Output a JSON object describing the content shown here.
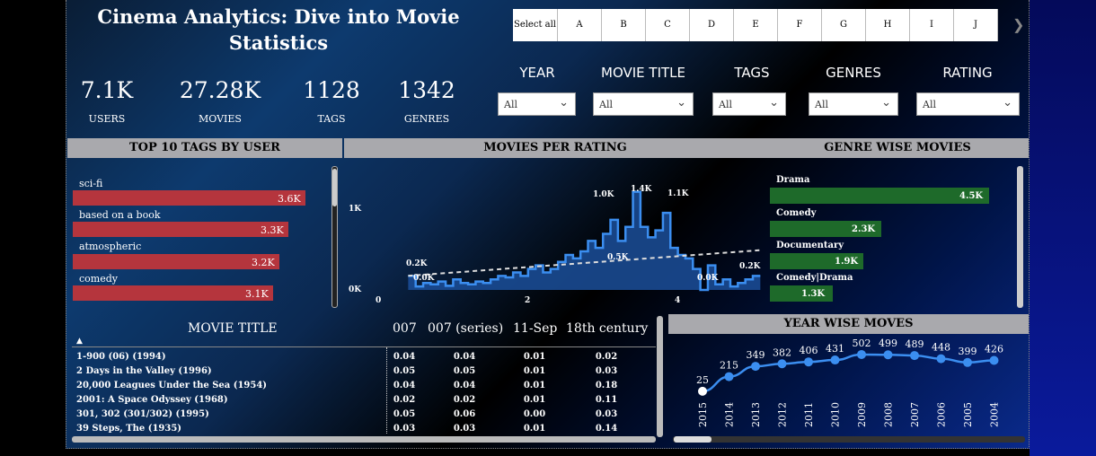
{
  "header": {
    "title": "Cinema Analytics: Dive into Movie Statistics"
  },
  "kpis": [
    {
      "value": "7.1K",
      "label": "USERS"
    },
    {
      "value": "27.28K",
      "label": "MOVIES"
    },
    {
      "value": "1128",
      "label": "TAGS"
    },
    {
      "value": "1342",
      "label": "GENRES"
    }
  ],
  "letter_slicer": [
    "Select all",
    "A",
    "B",
    "C",
    "D",
    "E",
    "F",
    "G",
    "H",
    "I",
    "J"
  ],
  "filters": [
    {
      "label": "YEAR",
      "value": "All"
    },
    {
      "label": "MOVIE TITLE",
      "value": "All"
    },
    {
      "label": "TAGS",
      "value": "All"
    },
    {
      "label": "GENRES",
      "value": "All"
    },
    {
      "label": "RATING",
      "value": "All"
    }
  ],
  "icons": {
    "next": "chevron-right-icon",
    "dropdown": "chevron-down-icon",
    "sort": "sort-ascending-icon"
  },
  "colors": {
    "tag_bar": "#b5353d",
    "genre_bar": "#1e6a2a",
    "histogram": "#3b8ef0",
    "line": "#3b8ef0",
    "header_bg": "#a9a9ad"
  },
  "top_tags": {
    "title": "TOP 10 TAGS BY USER",
    "items": [
      {
        "label": "sci-fi",
        "value": "3.6K",
        "num": 3.6
      },
      {
        "label": "based on a book",
        "value": "3.3K",
        "num": 3.3
      },
      {
        "label": "atmospheric",
        "value": "3.2K",
        "num": 3.2
      },
      {
        "label": "comedy",
        "value": "3.1K",
        "num": 3.1
      }
    ]
  },
  "genre_movies": {
    "title": "GENRE WISE MOVIES",
    "items": [
      {
        "label": "Drama",
        "value": "4.5K",
        "num": 4.5
      },
      {
        "label": "Comedy",
        "value": "2.3K",
        "num": 2.3
      },
      {
        "label": "Documentary",
        "value": "1.9K",
        "num": 1.9
      },
      {
        "label": "Comedy|Drama",
        "value": "1.3K",
        "num": 1.3
      }
    ]
  },
  "chart_data": [
    {
      "type": "area",
      "title": "MOVIES PER RATING",
      "x_ticks": [
        "0",
        "2",
        "4"
      ],
      "y_ticks": [
        "0K",
        "1K"
      ],
      "xlim": [
        0,
        5
      ],
      "ylim": [
        0,
        1.6
      ],
      "x": [
        0.4,
        0.5,
        0.6,
        0.7,
        0.8,
        0.9,
        1.0,
        1.1,
        1.2,
        1.3,
        1.4,
        1.5,
        1.6,
        1.7,
        1.8,
        1.9,
        2.0,
        2.1,
        2.2,
        2.3,
        2.4,
        2.5,
        2.6,
        2.7,
        2.8,
        2.9,
        3.0,
        3.1,
        3.2,
        3.3,
        3.4,
        3.5,
        3.6,
        3.7,
        3.8,
        3.9,
        4.0,
        4.1,
        4.2,
        4.3,
        4.4,
        4.5,
        4.6,
        4.7,
        4.8,
        4.9,
        5.0
      ],
      "y": [
        0.2,
        0.05,
        0.1,
        0.08,
        0.12,
        0.06,
        0.15,
        0.1,
        0.08,
        0.12,
        0.1,
        0.15,
        0.2,
        0.18,
        0.25,
        0.2,
        0.3,
        0.35,
        0.25,
        0.3,
        0.4,
        0.5,
        0.45,
        0.55,
        0.7,
        0.6,
        0.8,
        1.0,
        0.7,
        0.9,
        1.4,
        0.9,
        0.75,
        0.85,
        1.1,
        0.6,
        0.5,
        0.45,
        0.3,
        0.0,
        0.35,
        0.08,
        0.15,
        0.05,
        0.1,
        0.15,
        0.2
      ],
      "data_labels": [
        "0.2K",
        "0.0K",
        "1.0K",
        "1.4K",
        "1.1K",
        "0.5K",
        "0.0K",
        "0.2K"
      ],
      "trendline": true
    },
    {
      "type": "line",
      "title": "YEAR WISE MOVES",
      "categories": [
        "2015",
        "2014",
        "2013",
        "2012",
        "2011",
        "2010",
        "2009",
        "2008",
        "2007",
        "2006",
        "2005",
        "2004"
      ],
      "values": [
        25,
        215,
        349,
        382,
        406,
        431,
        502,
        499,
        489,
        448,
        399,
        426
      ],
      "ylim": [
        0,
        560
      ]
    }
  ],
  "movie_table": {
    "title": "MOVIE TITLE",
    "columns": [
      "007",
      "007 (series)",
      "11-Sep",
      "18th century"
    ],
    "rows": [
      {
        "title": "1-900 (06) (1994)",
        "cells": [
          "0.04",
          "0.04",
          "0.01",
          "0.02"
        ]
      },
      {
        "title": "2 Days in the Valley (1996)",
        "cells": [
          "0.05",
          "0.05",
          "0.01",
          "0.03"
        ]
      },
      {
        "title": "20,000 Leagues Under the Sea (1954)",
        "cells": [
          "0.04",
          "0.04",
          "0.01",
          "0.18"
        ]
      },
      {
        "title": "2001: A Space Odyssey (1968)",
        "cells": [
          "0.02",
          "0.02",
          "0.01",
          "0.11"
        ]
      },
      {
        "title": "301, 302 (301/302) (1995)",
        "cells": [
          "0.05",
          "0.06",
          "0.00",
          "0.03"
        ]
      },
      {
        "title": "39 Steps, The (1935)",
        "cells": [
          "0.03",
          "0.03",
          "0.01",
          "0.14"
        ]
      }
    ]
  }
}
